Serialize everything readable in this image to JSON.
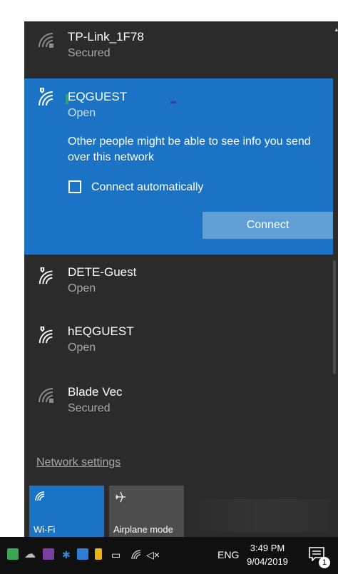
{
  "networks": {
    "n1": {
      "name": "TP-Link_1F78",
      "status": "Secured"
    },
    "selected": {
      "name": "EQGUEST",
      "status": "Open",
      "warning": "Other people might be able to see info you send over this network",
      "auto_label": "Connect automatically",
      "connect_label": "Connect"
    },
    "n3": {
      "name": "DETE-Guest",
      "status": "Open"
    },
    "n4": {
      "name": "hEQGUEST",
      "status": "Open"
    },
    "n5": {
      "name": "Blade Vec",
      "status": "Secured"
    }
  },
  "network_settings": "Network settings",
  "tiles": {
    "wifi": "Wi-Fi",
    "airplane": "Airplane mode"
  },
  "taskbar": {
    "lang": "ENG",
    "time": "3:49 PM",
    "date": "9/04/2019",
    "notification_count": "1",
    "tray_icons": [
      "app-green-icon",
      "cloud-icon",
      "onenote-icon",
      "bluetooth-icon",
      "app-blue-icon",
      "app-yellow-icon",
      "battery-icon",
      "wifi-icon",
      "volume-mute-icon"
    ]
  },
  "colors": {
    "accent": "#1a73c4",
    "flyout_bg": "#2b2b2b",
    "connect_btn": "#5f9fd6"
  }
}
